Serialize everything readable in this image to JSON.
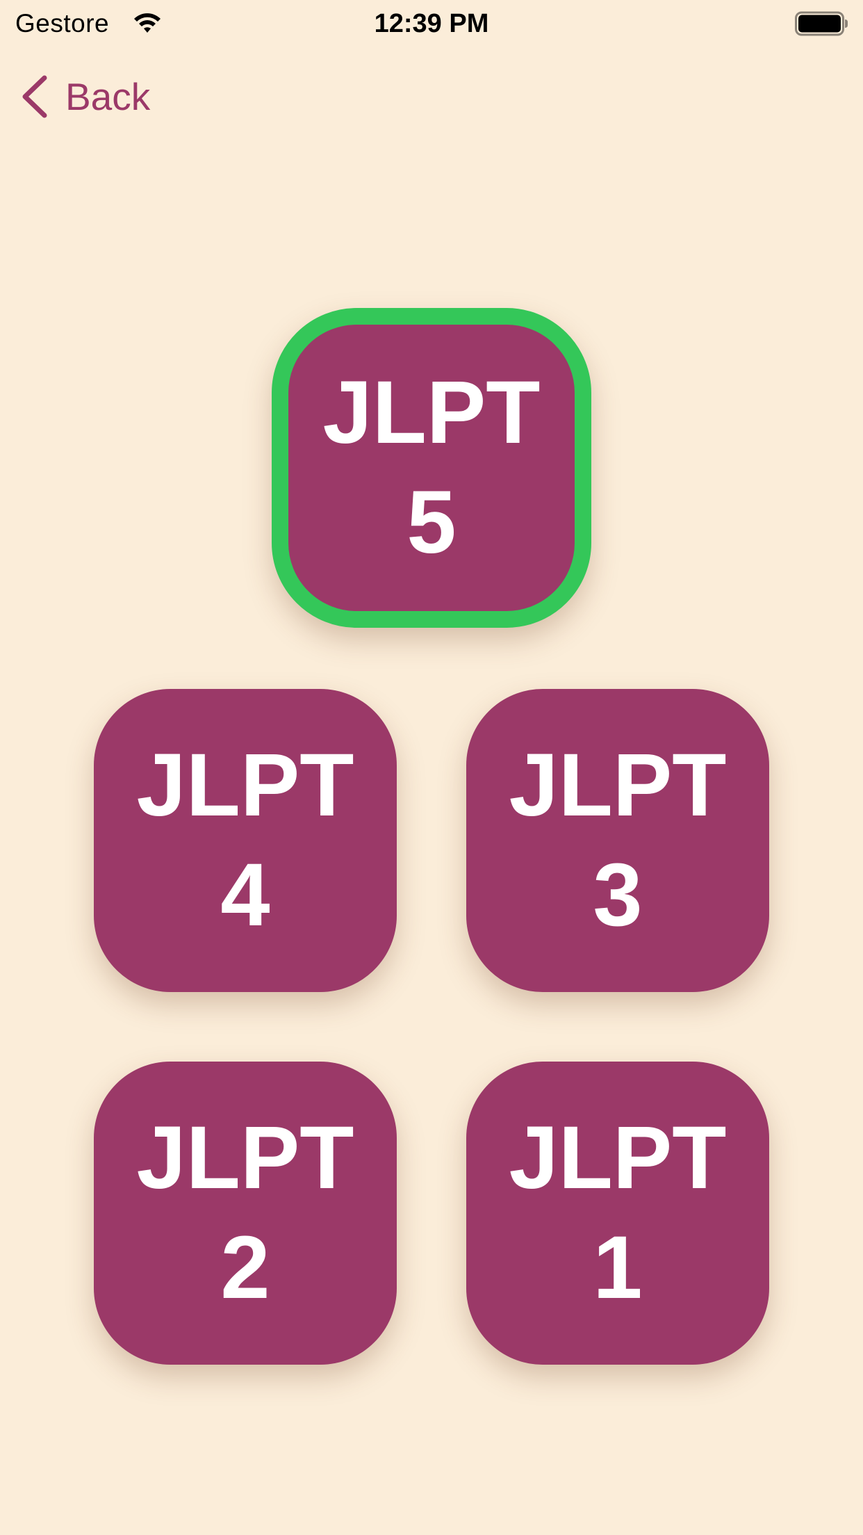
{
  "status_bar": {
    "carrier": "Gestore",
    "time": "12:39 PM",
    "wifi_icon": "wifi-icon",
    "battery_icon": "battery-icon"
  },
  "nav": {
    "back_label": "Back",
    "back_icon": "chevron-left-icon"
  },
  "colors": {
    "background": "#FBEDD9",
    "accent": "#9B3968",
    "tile": "#9B3968",
    "selected_border": "#34C759",
    "tile_text": "#FFFFFF"
  },
  "levels": [
    {
      "line1": "JLPT",
      "line2": "5",
      "selected": true
    },
    {
      "line1": "JLPT",
      "line2": "4",
      "selected": false
    },
    {
      "line1": "JLPT",
      "line2": "3",
      "selected": false
    },
    {
      "line1": "JLPT",
      "line2": "2",
      "selected": false
    },
    {
      "line1": "JLPT",
      "line2": "1",
      "selected": false
    }
  ]
}
